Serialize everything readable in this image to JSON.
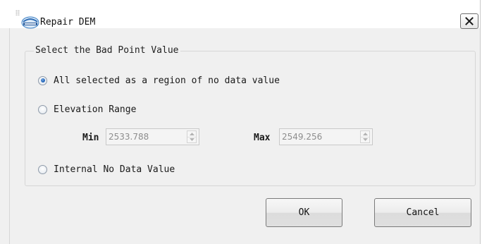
{
  "dialog": {
    "title": "Repair DEM",
    "logo_icon": "app-logo-icon",
    "close_icon": "close-icon"
  },
  "group": {
    "title": "Select the Bad Point Value",
    "options": [
      {
        "label": "All selected as a region of no data value",
        "checked": true
      },
      {
        "label": "Elevation Range",
        "checked": false
      },
      {
        "label": "Internal No Data Value",
        "checked": false
      }
    ],
    "range": {
      "min_label": "Min",
      "min_value": "2533.788",
      "max_label": "Max",
      "max_value": "2549.256",
      "enabled": false
    }
  },
  "buttons": {
    "ok": "OK",
    "cancel": "Cancel"
  },
  "colors": {
    "dialog_bg": "#f0f0f0",
    "titlebar_bg": "#ffffff",
    "radio_selected": "#1d5fb3",
    "disabled_text": "#8d8d8d"
  }
}
